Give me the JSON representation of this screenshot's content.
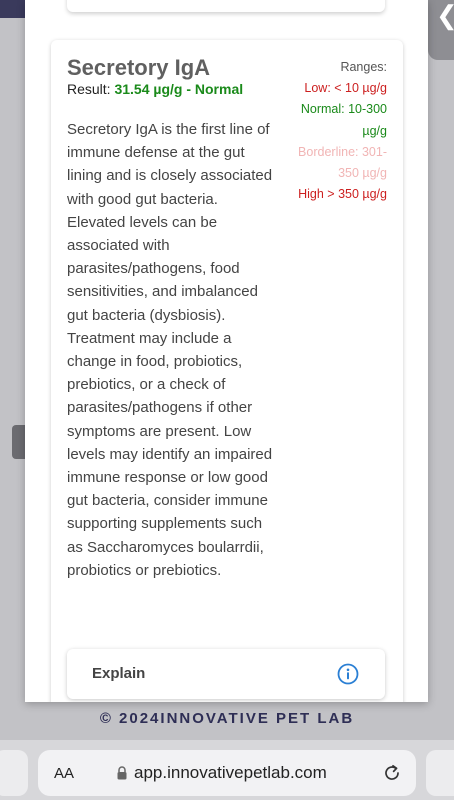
{
  "background": {
    "back_chevron": "❮",
    "copyright": "© 2024INNOVATIVE PET LAB"
  },
  "card": {
    "title": "Secretory IgA",
    "result_label": "Result:",
    "result_value": "31.54 µg/g - Normal",
    "description": "Secretory IgA is the first line of immune defense at the gut lining and is closely associated with good gut bacteria. Elevated levels can be associated with parasites/pathogens, food sensitivities, and imbalanced gut bacteria (dysbiosis). Treatment may include a change in food, probiotics, prebiotics, or a check of parasites/pathogens if other symptoms are present. Low levels may identify an impaired immune response or low good gut bacteria, consider immune supporting supplements such as Saccharomyces boularrdii, probiotics or prebiotics.",
    "ranges": {
      "heading": "Ranges:",
      "low": "Low: < 10 µg/g",
      "normal": "Normal: 10-300 µg/g",
      "borderline": "Borderline: 301-350 µg/g",
      "high": "High > 350 µg/g"
    },
    "explain_label": "Explain"
  },
  "browser": {
    "aa_label": "AA",
    "url": "app.innovativepetlab.com"
  },
  "colors": {
    "normal": "#1a8a1a",
    "low_high": "#cc1f1f",
    "borderline": "#f1b5b5",
    "info": "#2a7fd4"
  },
  "icons": [
    "info-icon",
    "lock-icon",
    "reload-icon",
    "back-chevron-icon"
  ]
}
